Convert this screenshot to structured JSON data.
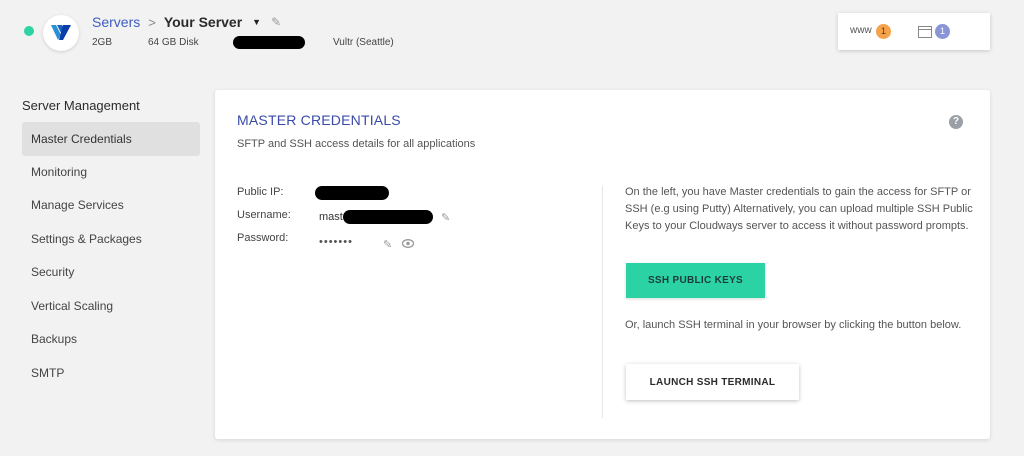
{
  "header": {
    "breadcrumb_parent": "Servers",
    "breadcrumb_sep": ">",
    "server_name": "Your Server",
    "specs": {
      "ram": "2GB",
      "disk": "64 GB Disk",
      "location": "Vultr (Seattle)"
    },
    "widget": {
      "www_label": "www",
      "www_count": "1",
      "apps_count": "1"
    },
    "status_color": "#2ed3a4",
    "provider_logo": "vultr-logo"
  },
  "sidebar": {
    "title": "Server Management",
    "items": [
      {
        "label": "Master Credentials",
        "active": true
      },
      {
        "label": "Monitoring"
      },
      {
        "label": "Manage Services"
      },
      {
        "label": "Settings & Packages"
      },
      {
        "label": "Security"
      },
      {
        "label": "Vertical Scaling"
      },
      {
        "label": "Backups"
      },
      {
        "label": "SMTP"
      }
    ]
  },
  "main": {
    "title": "MASTER CREDENTIALS",
    "subtitle": "SFTP and SSH access details for all applications",
    "help_icon": "?",
    "fields": {
      "public_ip_label": "Public IP:",
      "username_label": "Username:",
      "username_prefix": "mast",
      "password_label": "Password:",
      "password_mask": "•••••••"
    },
    "info_text_1": "On the left, you have Master credentials to gain the access for SFTP or SSH (e.g using Putty) Alternatively, you can upload multiple SSH Public Keys to your Cloudways server to access it without password prompts.",
    "ssh_keys_button": "SSH PUBLIC KEYS",
    "info_text_2": "Or, launch SSH terminal in your browser by clicking the button below.",
    "terminal_button": "LAUNCH SSH TERMINAL"
  },
  "colors": {
    "accent_green": "#2bd3a4",
    "title_blue": "#3a4aa8",
    "link_blue": "#3f5bc2",
    "www_badge": "#f6a24a",
    "apps_badge": "#8a95d8"
  }
}
